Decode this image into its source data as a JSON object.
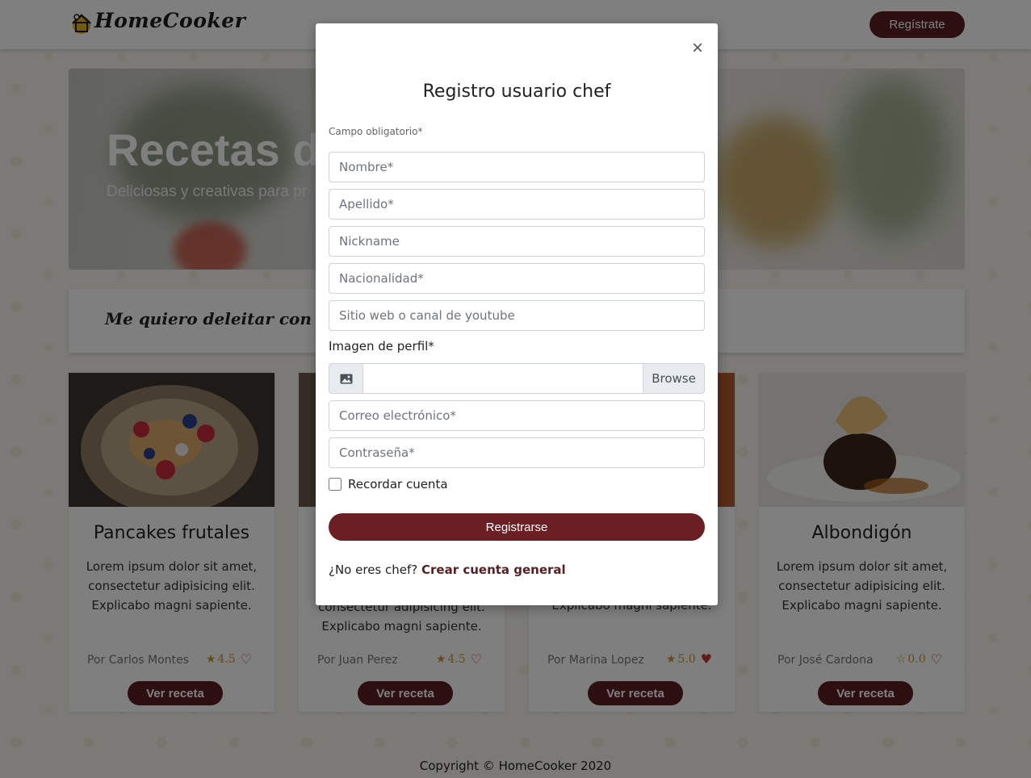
{
  "navbar": {
    "brand": "HomeCooker",
    "register_label": "Regístrate"
  },
  "hero": {
    "title": "Recetas de",
    "subtitle": "Deliciosas y creativas para pr"
  },
  "filter": {
    "label": "Me quiero deleitar con"
  },
  "recipes": [
    {
      "title": "Pancakes frutales",
      "text": "Lorem ipsum dolor sit amet, consectetur adipisicing elit. Explicabo magni sapiente.",
      "author": "Por Carlos Montes",
      "rating": "4.5",
      "favorited": false,
      "button": "Ver receta"
    },
    {
      "title": "",
      "text": "consectetur adipisicing elit. Explicabo magni sapiente.",
      "author": "Por Juan Perez",
      "rating": "4.5",
      "favorited": false,
      "button": "Ver receta"
    },
    {
      "title": "",
      "text": "Explicabo magni sapiente.",
      "author": "Por Marina Lopez",
      "rating": "5.0",
      "favorited": true,
      "button": "Ver receta"
    },
    {
      "title": "Albondigón",
      "text": "Lorem ipsum dolor sit amet, consectetur adipisicing elit. Explicabo magni sapiente.",
      "author": "Por José Cardona",
      "rating": "0.0",
      "favorited": false,
      "button": "Ver receta"
    }
  ],
  "footer": {
    "copyright": "Copyright © HomeCooker 2020"
  },
  "modal": {
    "close_label": "×",
    "title": "Registro usuario chef",
    "required_note": "Campo obligatorio*",
    "fields": {
      "nombre": "Nombre*",
      "apellido": "Apellido*",
      "nickname": "Nickname",
      "nacionalidad": "Nacionalidad*",
      "sitio": "Sitio web o canal de youtube",
      "correo": "Correo electrónico*",
      "contrasena": "Contraseña*"
    },
    "profile_image_label": "Imagen de perfil*",
    "browse_label": "Browse",
    "remember_label": "Recordar cuenta",
    "submit_label": "Registrarse",
    "not_chef_text": "¿No eres chef?",
    "general_account_link": "Crear cuenta general"
  },
  "colors": {
    "brand_maroon": "#5a1e22",
    "star_gold": "#c9962a",
    "heart_red": "#c0392b"
  }
}
